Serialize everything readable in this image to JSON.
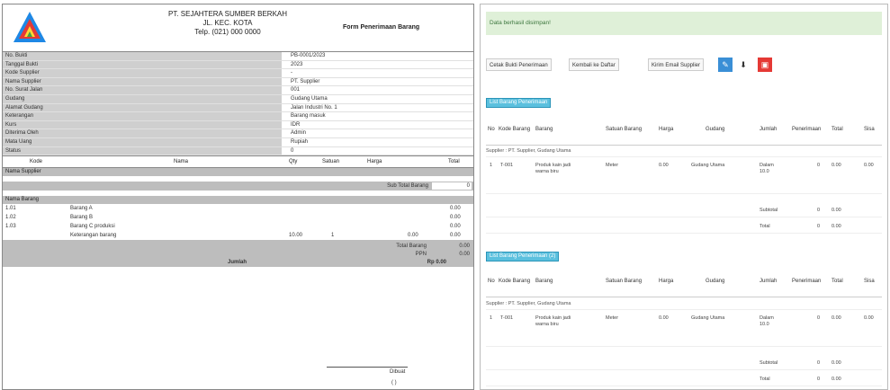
{
  "voucher": {
    "company_lines": [
      "PT. SEJAHTERA SUMBER BERKAH",
      "JL. KEC. KOTA",
      "Telp. (021) 000 0000"
    ],
    "doc_title": "Form Penerimaan Barang",
    "info_rows": [
      {
        "label": "No. Bukti",
        "value": "PB-0001/2023"
      },
      {
        "label": "Tanggal Bukti",
        "value": "2023"
      },
      {
        "label": "Kode Supplier",
        "value": "-"
      },
      {
        "label": "Nama Supplier",
        "value": "PT. Supplier"
      },
      {
        "label": "No. Surat Jalan",
        "value": "001"
      },
      {
        "label": "Gudang",
        "value": "Gudang Utama"
      },
      {
        "label": "Alamat Gudang",
        "value": "Jalan Industri No. 1"
      },
      {
        "label": "Keterangan",
        "value": "Barang masuk"
      },
      {
        "label": "Kurs",
        "value": "IDR"
      },
      {
        "label": "Diterima Oleh",
        "value": "Admin"
      },
      {
        "label": "Mata Uang",
        "value": "Rupiah"
      },
      {
        "label": "Status",
        "value": "0"
      }
    ],
    "table_headers": {
      "kode": "Kode",
      "nama": "Nama",
      "qty": "Qty",
      "satuan": "Satuan",
      "harga": "Harga",
      "total": "Total"
    },
    "section_1": "Nama Supplier",
    "sum_1_label": "Sub Total Barang",
    "sum_1_value": "0",
    "section_2": "Nama Barang",
    "detail_rows": [
      {
        "kode": "1.01",
        "nama": "Barang A",
        "total": "0.00"
      },
      {
        "kode": "1.02",
        "nama": "Barang B",
        "total": "0.00"
      },
      {
        "kode": "1.03",
        "nama": "Barang C produksi",
        "total": "0.00"
      },
      {
        "kode": "",
        "nama": "Keterangan barang",
        "qty": "10.00",
        "satuan": "1",
        "harga": "0.00",
        "total": "0.00"
      }
    ],
    "gray_totals": [
      {
        "label": "Total Barang",
        "value": "0.00"
      },
      {
        "label": "PPN",
        "value": "0.00"
      }
    ],
    "grand_label": "Jumlah",
    "grand_value": "Rp 0.00",
    "sign_title": "Dibuat",
    "sign_name": "( )"
  },
  "list": {
    "success_msg": "Data berhasil disimpan!",
    "toolbar": {
      "btn1": "Cetak Bukti Penerimaan",
      "btn2": "Kembali ke Daftar",
      "btn3": "Kirim Email Supplier",
      "icon_blue": "edit-icon",
      "icon_down": "download-icon",
      "icon_red": "pdf-icon"
    },
    "section_a_tag": "List Barang Penerimaan",
    "section_b_tag": "List Barang Penerimaan (2)",
    "headers": {
      "no": "No",
      "kode": "Kode Barang",
      "barang": "Barang",
      "satuan": "Satuan Barang",
      "harga": "Harga",
      "gudang": "Gudang",
      "jumlah": "Jumlah",
      "penerimaan": "Penerimaan",
      "total": "Total",
      "sisa": "Sisa"
    },
    "group_a": "Supplier : PT. Supplier, Gudang Utama",
    "group_b": "Supplier : PT. Supplier, Gudang Utama",
    "row_a": {
      "no": "1",
      "kode": "T-001",
      "barang": "Produk kain jadi warna biru",
      "satuan": "Meter",
      "harga": "0.00",
      "gudang": "Gudang Utama",
      "jumlah": "Dalam 10.0",
      "penerimaan": "0",
      "total": "0.00",
      "sisa": "0.00"
    },
    "row_b": {
      "no": "1",
      "kode": "T-001",
      "barang": "Produk kain jadi warna biru",
      "satuan": "Meter",
      "harga": "0.00",
      "gudang": "Gudang Utama",
      "jumlah": "Dalam 10.0",
      "penerimaan": "0",
      "total": "0.00",
      "sisa": "0.00"
    },
    "sum_a1": {
      "label": "Subtotal",
      "qty": "0",
      "total": "0.00"
    },
    "sum_a2": {
      "label": "Total",
      "qty": "0",
      "total": "0.00"
    },
    "sum_b1": {
      "label": "Subtotal",
      "qty": "0",
      "total": "0.00"
    },
    "sum_b2": {
      "label": "Total",
      "qty": "0",
      "total": "0.00"
    }
  }
}
